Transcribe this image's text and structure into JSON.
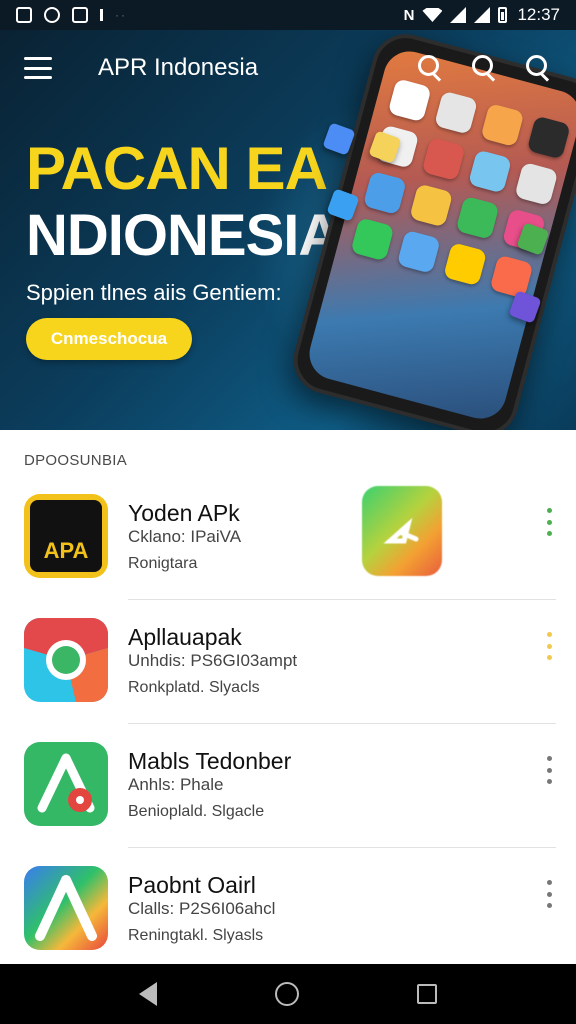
{
  "status_bar": {
    "time": "12:37",
    "notification_badge": "N"
  },
  "app_bar": {
    "title": "APR Indonesia",
    "menu_icon": "menu-icon",
    "search_icons": [
      "search-icon",
      "search-icon",
      "search-icon"
    ]
  },
  "hero": {
    "line1": "PACAN EA",
    "line2": "NDIONESIA",
    "subtitle": "Sppien tlnes aiis Gentiem:",
    "cta_label": "Cnmeschocua",
    "colors": {
      "headline": "#f7d51d",
      "cta": "#f7d51d",
      "background": "#0b3d5c"
    }
  },
  "section": {
    "label": "DPOOSUNBIA"
  },
  "apps": [
    {
      "title": "Yoden APk",
      "line1": "Cklano: IPaiVA",
      "line2": "Ronigtara",
      "icon": "apk-logo-icon",
      "icon_text": "APA",
      "more_color": "green"
    },
    {
      "title": "Apllauapak",
      "line1": "Unhdis: PS6GI03ampt",
      "line2": "Ronkplatd. Slyacls",
      "icon": "chrome-style-icon",
      "more_color": "yellow"
    },
    {
      "title": "Mabls Tedonber",
      "line1": "Anhls: Phale",
      "line2": "Benioplald. Slgacle",
      "icon": "triangle-app-icon",
      "more_color": "gray"
    },
    {
      "title": "Paobnt Oairl",
      "line1": "Clalls: P2S6I06ahcl",
      "line2": "Reningtakl. Slyasls",
      "icon": "prism-app-icon",
      "more_color": "gray"
    }
  ],
  "promo_icon": "play-store-style-icon",
  "nav_bar": {
    "back": "back-icon",
    "home": "home-icon",
    "recent": "recent-apps-icon"
  }
}
